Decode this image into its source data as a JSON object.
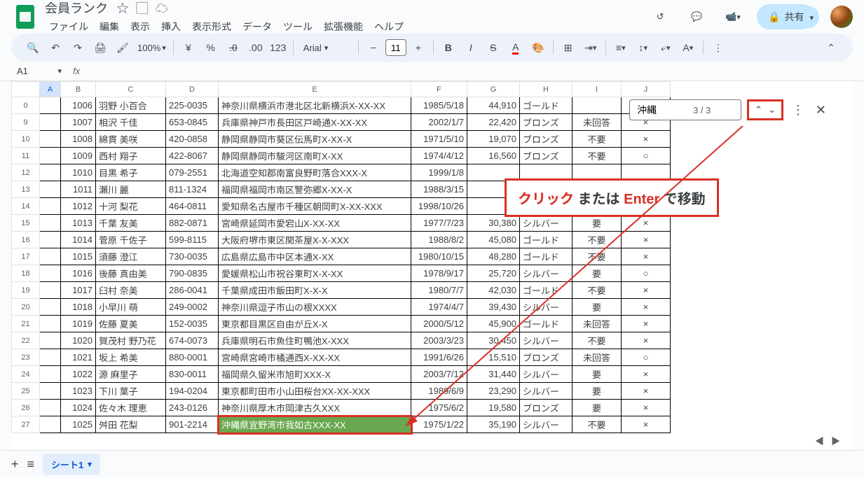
{
  "doc": {
    "title": "会員ランク"
  },
  "menu": {
    "items": [
      "ファイル",
      "編集",
      "表示",
      "挿入",
      "表示形式",
      "データ",
      "ツール",
      "拡張機能",
      "ヘルプ"
    ]
  },
  "share": {
    "label": "共有"
  },
  "toolbar": {
    "zoom": "100%",
    "currency": "¥",
    "pct": "%",
    "dec_dec": ".0",
    "dec_inc": ".00",
    "num_fmt": "123",
    "font": "Arial",
    "font_size": "11"
  },
  "namebox": "A1",
  "col_headers": [
    "",
    "A",
    "B",
    "C",
    "D",
    "E",
    "F",
    "G",
    "H",
    "I",
    "J"
  ],
  "search": {
    "value": "沖縄",
    "count": "3 / 3"
  },
  "annotation": {
    "p1": "クリック",
    "p2": " または ",
    "p3": "Enter",
    "p4": " で移動"
  },
  "tab": {
    "name": "シート1"
  },
  "rows": [
    {
      "n": "0",
      "b": "1006",
      "c": "羽野 小百合",
      "d": "225-0035",
      "e": "神奈川県横浜市港北区北新横浜X-XX-XX",
      "f": "1985/5/18",
      "g": "44,910",
      "h": "ゴールド",
      "i": "",
      "j": ""
    },
    {
      "n": "9",
      "b": "1007",
      "c": "相沢 千佳",
      "d": "653-0845",
      "e": "兵庫県神戸市長田区戸崎通X-XX-XX",
      "f": "2002/1/7",
      "g": "22,420",
      "h": "ブロンズ",
      "i": "未回答",
      "j": "×"
    },
    {
      "n": "10",
      "b": "1008",
      "c": "綿貫 美咲",
      "d": "420-0858",
      "e": "静岡県静岡市葵区伝馬町X-XX-X",
      "f": "1971/5/10",
      "g": "19,070",
      "h": "ブロンズ",
      "i": "不要",
      "j": "×"
    },
    {
      "n": "11",
      "b": "1009",
      "c": "西村 翔子",
      "d": "422-8067",
      "e": "静岡県静岡市駿河区南町X-XX",
      "f": "1974/4/12",
      "g": "16,560",
      "h": "ブロンズ",
      "i": "不要",
      "j": "○"
    },
    {
      "n": "12",
      "b": "1010",
      "c": "目黒 希子",
      "d": "079-2551",
      "e": "北海道空知郡南富良野町落合XXX-X",
      "f": "1999/1/8",
      "g": "",
      "h": "",
      "i": "",
      "j": ""
    },
    {
      "n": "13",
      "b": "1011",
      "c": "瀬川 麗",
      "d": "811-1324",
      "e": "福岡県福岡市南区警弥郷X-XX-X",
      "f": "1988/3/15",
      "g": "",
      "h": "",
      "i": "",
      "j": ""
    },
    {
      "n": "14",
      "b": "1012",
      "c": "十河 梨花",
      "d": "464-0811",
      "e": "愛知県名古屋市千種区朝岡町X-XX-XXX",
      "f": "1998/10/26",
      "g": "",
      "h": "",
      "i": "",
      "j": ""
    },
    {
      "n": "15",
      "b": "1013",
      "c": "千葉 友美",
      "d": "882-0871",
      "e": "宮崎県延岡市愛宕山X-XX-XX",
      "f": "1977/7/23",
      "g": "30,380",
      "h": "シルバー",
      "i": "要",
      "j": "×"
    },
    {
      "n": "16",
      "b": "1014",
      "c": "菅原 千佐子",
      "d": "599-8115",
      "e": "大阪府堺市東区関茶屋X-X-XXX",
      "f": "1988/8/2",
      "g": "45,080",
      "h": "ゴールド",
      "i": "不要",
      "j": "×"
    },
    {
      "n": "17",
      "b": "1015",
      "c": "須藤 澄江",
      "d": "730-0035",
      "e": "広島県広島市中区本通X-XX",
      "f": "1980/10/15",
      "g": "48,280",
      "h": "ゴールド",
      "i": "不要",
      "j": "×"
    },
    {
      "n": "18",
      "b": "1016",
      "c": "後藤 真由美",
      "d": "790-0835",
      "e": "愛媛県松山市祝谷東町X-X-XX",
      "f": "1978/9/17",
      "g": "25,720",
      "h": "シルバー",
      "i": "要",
      "j": "○"
    },
    {
      "n": "19",
      "b": "1017",
      "c": "臼村 奈美",
      "d": "286-0041",
      "e": "千葉県成田市飯田町X-X-X",
      "f": "1980/7/7",
      "g": "42,030",
      "h": "ゴールド",
      "i": "不要",
      "j": "×"
    },
    {
      "n": "20",
      "b": "1018",
      "c": "小早川 萌",
      "d": "249-0002",
      "e": "神奈川県逗子市山の根XXXX",
      "f": "1974/4/7",
      "g": "39,430",
      "h": "シルバー",
      "i": "要",
      "j": "×"
    },
    {
      "n": "21",
      "b": "1019",
      "c": "佐藤 夏美",
      "d": "152-0035",
      "e": "東京都目黒区自由が丘X-X",
      "f": "2000/5/12",
      "g": "45,900",
      "h": "ゴールド",
      "i": "未回答",
      "j": "×"
    },
    {
      "n": "22",
      "b": "1020",
      "c": "賀茂村 野乃花",
      "d": "674-0073",
      "e": "兵庫県明石市魚住町鴨池X-XXX",
      "f": "2003/3/23",
      "g": "30,450",
      "h": "シルバー",
      "i": "不要",
      "j": "×"
    },
    {
      "n": "23",
      "b": "1021",
      "c": "坂上 希美",
      "d": "880-0001",
      "e": "宮崎県宮崎市橘通西X-XX-XX",
      "f": "1991/6/26",
      "g": "15,510",
      "h": "ブロンズ",
      "i": "未回答",
      "j": "○"
    },
    {
      "n": "24",
      "b": "1022",
      "c": "源 麻里子",
      "d": "830-0011",
      "e": "福岡県久留米市旭町XXX-X",
      "f": "2003/7/12",
      "g": "31,440",
      "h": "シルバー",
      "i": "要",
      "j": "×"
    },
    {
      "n": "25",
      "b": "1023",
      "c": "下川 葉子",
      "d": "194-0204",
      "e": "東京都町田市小山田桜台XX-XX-XXX",
      "f": "1989/6/9",
      "g": "23,290",
      "h": "シルバー",
      "i": "要",
      "j": "×"
    },
    {
      "n": "26",
      "b": "1024",
      "c": "佐々木 理恵",
      "d": "243-0126",
      "e": "神奈川県厚木市岡津古久XXX",
      "f": "1975/6/2",
      "g": "19,580",
      "h": "ブロンズ",
      "i": "要",
      "j": "×"
    },
    {
      "n": "27",
      "b": "1025",
      "c": "舛田 花梨",
      "d": "901-2214",
      "e": "沖縄県宜野湾市我如古XXX-XX",
      "f": "1975/1/22",
      "g": "35,190",
      "h": "シルバー",
      "i": "不要",
      "j": "×"
    }
  ]
}
